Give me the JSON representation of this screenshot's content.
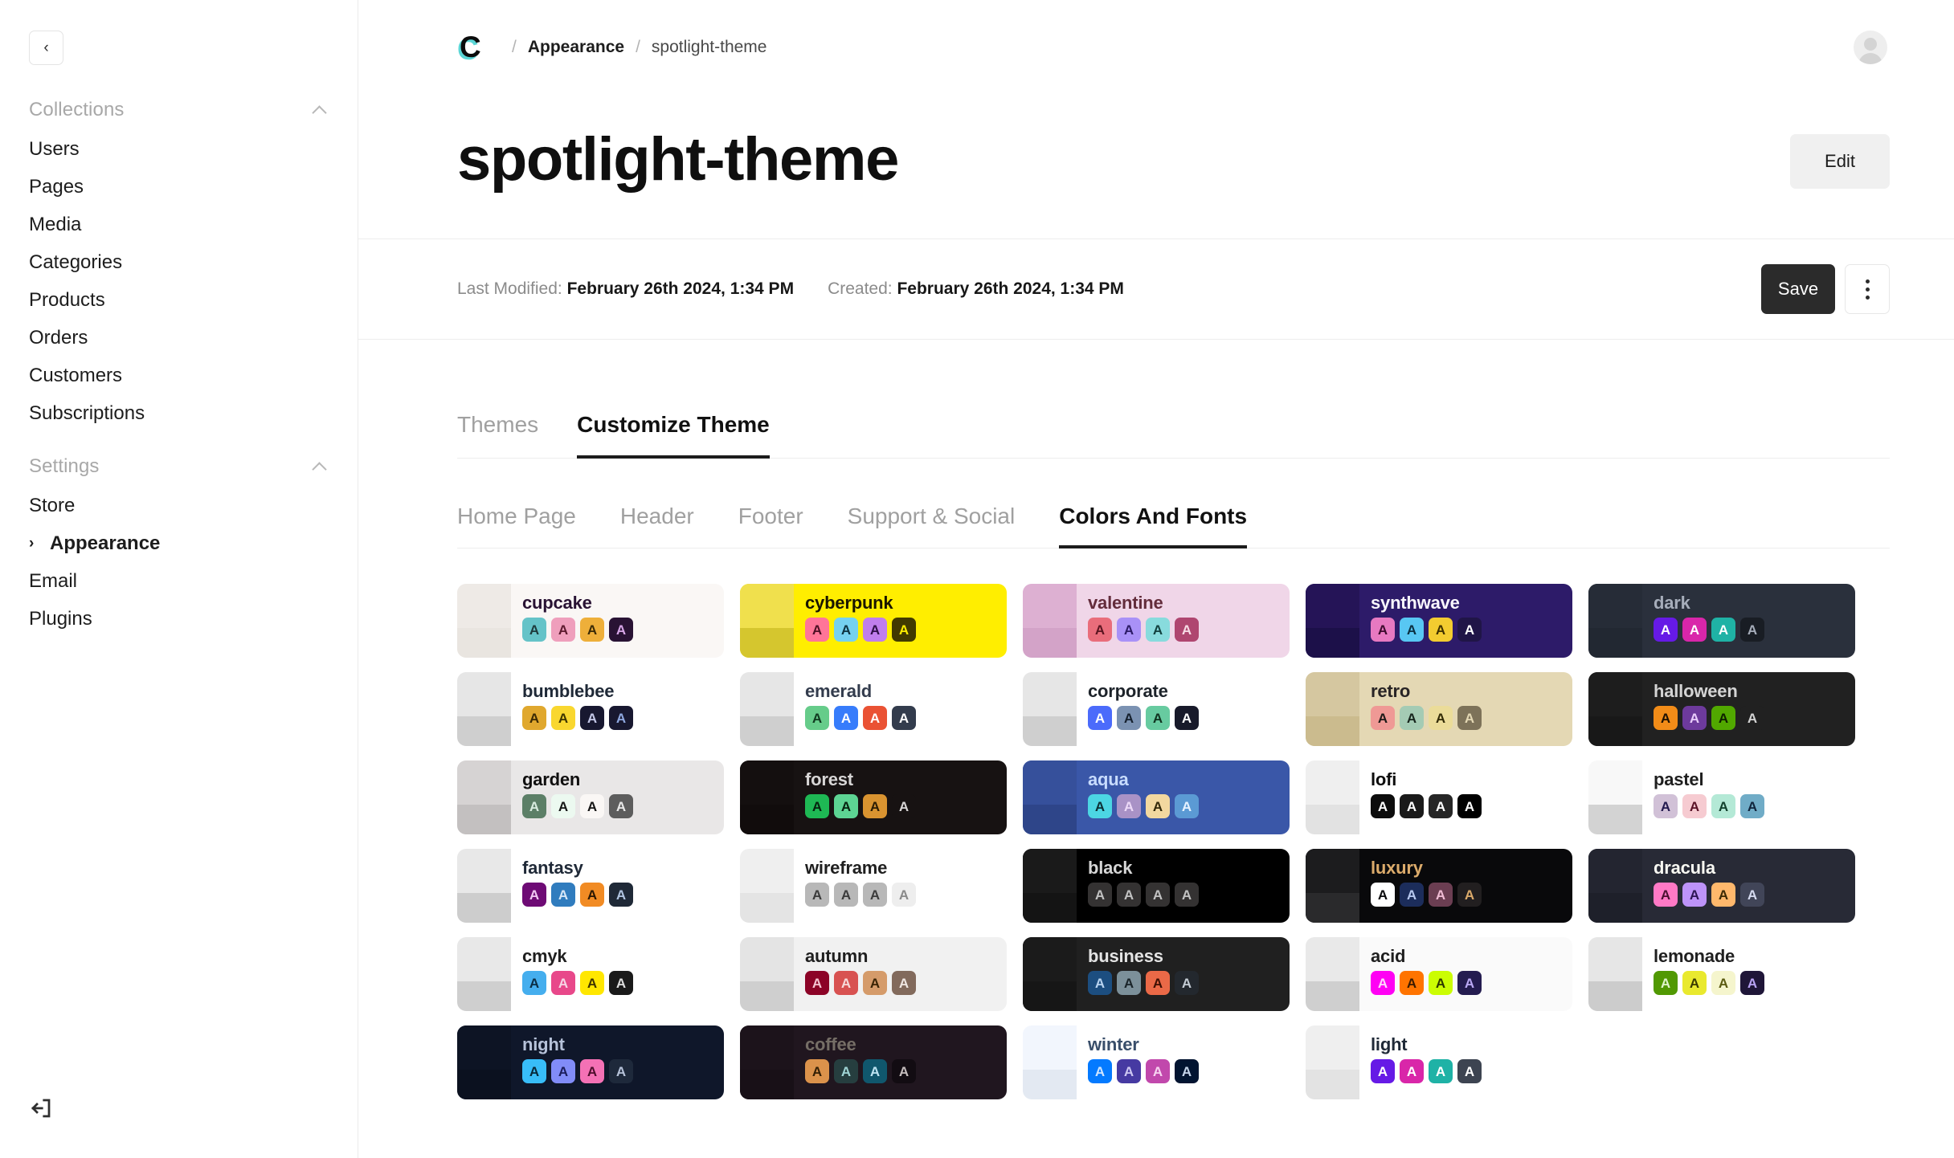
{
  "sidebar": {
    "collapse_label": "‹",
    "groups": [
      {
        "title": "Collections",
        "items": [
          {
            "label": "Users"
          },
          {
            "label": "Pages"
          },
          {
            "label": "Media"
          },
          {
            "label": "Categories"
          },
          {
            "label": "Products"
          },
          {
            "label": "Orders"
          },
          {
            "label": "Customers"
          },
          {
            "label": "Subscriptions"
          }
        ]
      },
      {
        "title": "Settings",
        "items": [
          {
            "label": "Store"
          },
          {
            "label": "Appearance",
            "active": true,
            "arrow": "›"
          },
          {
            "label": "Email"
          },
          {
            "label": "Plugins"
          }
        ]
      }
    ],
    "logout_icon": "logout-icon"
  },
  "topbar": {
    "logo_letter": "C",
    "breadcrumb": {
      "separator": "/",
      "parent": "Appearance",
      "current": "spotlight-theme"
    },
    "avatar_icon": "user-avatar-icon"
  },
  "header": {
    "title": "spotlight-theme",
    "edit_label": "Edit"
  },
  "meta": {
    "last_modified_label": "Last Modified:",
    "last_modified_value": "February 26th 2024, 1:34 PM",
    "created_label": "Created:",
    "created_value": "February 26th 2024, 1:34 PM",
    "save_label": "Save",
    "kebab_label": "More options"
  },
  "tabs_primary": [
    {
      "label": "Themes",
      "active": false
    },
    {
      "label": "Customize Theme",
      "active": true
    }
  ],
  "tabs_secondary": [
    {
      "label": "Home Page",
      "active": false
    },
    {
      "label": "Header",
      "active": false
    },
    {
      "label": "Footer",
      "active": false
    },
    {
      "label": "Support & Social",
      "active": false
    },
    {
      "label": "Colors And Fonts",
      "active": true
    }
  ],
  "themes": [
    {
      "name": "cupcake",
      "bg": "#faf7f5",
      "strip_top": "#eeeae6",
      "strip_bot": "#e9e5e0",
      "name_color": "#291334",
      "swatches": [
        {
          "bg": "#65c3c8",
          "fg": "#1e3a3b"
        },
        {
          "bg": "#ef9fbc",
          "fg": "#5c1a2e"
        },
        {
          "bg": "#eeaf3a",
          "fg": "#3a2a06"
        },
        {
          "bg": "#291334",
          "fg": "#d8a7e8"
        }
      ]
    },
    {
      "name": "cyberpunk",
      "bg": "#ffee00",
      "strip_top": "#f0e04d",
      "strip_bot": "#d5c62e",
      "name_color": "#1a1600",
      "swatches": [
        {
          "bg": "#ff7598",
          "fg": "#4d1024"
        },
        {
          "bg": "#75d1f0",
          "fg": "#0d3340"
        },
        {
          "bg": "#c07eec",
          "fg": "#2f0f47"
        },
        {
          "bg": "#423a00",
          "fg": "#ffee00"
        }
      ]
    },
    {
      "name": "valentine",
      "bg": "#f0d6e8",
      "strip_top": "#ddb0d2",
      "strip_bot": "#d3a3c8",
      "name_color": "#632c3b",
      "swatches": [
        {
          "bg": "#e96d7b",
          "fg": "#5a1520"
        },
        {
          "bg": "#a991f7",
          "fg": "#2c1b67"
        },
        {
          "bg": "#88dbdd",
          "fg": "#12413f"
        },
        {
          "bg": "#af4670",
          "fg": "#f7dce6"
        }
      ]
    },
    {
      "name": "synthwave",
      "bg": "#2d1b69",
      "strip_top": "#251457",
      "strip_bot": "#1c1049",
      "name_color": "#f9f7fd",
      "swatches": [
        {
          "bg": "#e779c1",
          "fg": "#3b0a2c"
        },
        {
          "bg": "#58c7f3",
          "fg": "#0b2f40"
        },
        {
          "bg": "#f3cc30",
          "fg": "#3d3000"
        },
        {
          "bg": "#201547",
          "fg": "#ffffff"
        }
      ]
    },
    {
      "name": "dark",
      "bg": "#2a303c",
      "strip_top": "#262c37",
      "strip_bot": "#222832",
      "name_color": "#a6adba",
      "swatches": [
        {
          "bg": "#661ae6",
          "fg": "#ffffff"
        },
        {
          "bg": "#d926aa",
          "fg": "#ffffff"
        },
        {
          "bg": "#1fb2a5",
          "fg": "#ffffff"
        },
        {
          "bg": "#191d24",
          "fg": "#a6adba"
        }
      ]
    },
    {
      "name": "bumblebee",
      "bg": "#ffffff",
      "strip_top": "#e6e6e6",
      "strip_bot": "#cfcfcf",
      "name_color": "#1f2937",
      "swatches": [
        {
          "bg": "#e0a82e",
          "fg": "#3b2a04"
        },
        {
          "bg": "#f9d72f",
          "fg": "#3d3400"
        },
        {
          "bg": "#181830",
          "fg": "#c5c8e8"
        },
        {
          "bg": "#181830",
          "fg": "#8fa8e0"
        }
      ]
    },
    {
      "name": "emerald",
      "bg": "#ffffff",
      "strip_top": "#e6e6e6",
      "strip_bot": "#cfcfcf",
      "name_color": "#333c4d",
      "swatches": [
        {
          "bg": "#66cc8a",
          "fg": "#10391f"
        },
        {
          "bg": "#377cfb",
          "fg": "#ffffff"
        },
        {
          "bg": "#ea5234",
          "fg": "#ffffff"
        },
        {
          "bg": "#333c4d",
          "fg": "#ffffff"
        }
      ]
    },
    {
      "name": "corporate",
      "bg": "#ffffff",
      "strip_top": "#e6e6e6",
      "strip_bot": "#cfcfcf",
      "name_color": "#1d232a",
      "swatches": [
        {
          "bg": "#4b6bfb",
          "fg": "#ffffff"
        },
        {
          "bg": "#7b92b2",
          "fg": "#15202e"
        },
        {
          "bg": "#67cba0",
          "fg": "#10331f"
        },
        {
          "bg": "#181a2a",
          "fg": "#ffffff"
        }
      ]
    },
    {
      "name": "retro",
      "bg": "#e4d8b4",
      "strip_top": "#d5c7a0",
      "strip_bot": "#cbbb8e",
      "name_color": "#282425",
      "swatches": [
        {
          "bg": "#ef9995",
          "fg": "#1c1917"
        },
        {
          "bg": "#a4cbb4",
          "fg": "#16241c"
        },
        {
          "bg": "#ebdc99",
          "fg": "#322b06"
        },
        {
          "bg": "#7d7259",
          "fg": "#e4d8b4"
        }
      ]
    },
    {
      "name": "halloween",
      "bg": "#212121",
      "strip_top": "#1d1d1d",
      "strip_bot": "#181818",
      "name_color": "#d4d4d4",
      "swatches": [
        {
          "bg": "#f28c18",
          "fg": "#1d1102"
        },
        {
          "bg": "#6d3a9c",
          "fg": "#e9cdfb"
        },
        {
          "bg": "#51a800",
          "fg": "#0e1f00"
        },
        {
          "bg": "#212121",
          "fg": "#d4d4d4"
        }
      ]
    },
    {
      "name": "garden",
      "bg": "#e9e7e7",
      "strip_top": "#d6d3d3",
      "strip_bot": "#c3c0c0",
      "name_color": "#100f0f",
      "swatches": [
        {
          "bg": "#5c7f67",
          "fg": "#d9ece0"
        },
        {
          "bg": "#ecf9f0",
          "fg": "#151515"
        },
        {
          "bg": "#faf7f5",
          "fg": "#151515"
        },
        {
          "bg": "#5d5d5d",
          "fg": "#e8e8e8"
        }
      ]
    },
    {
      "name": "forest",
      "bg": "#171212",
      "strip_top": "#140f0f",
      "strip_bot": "#110c0c",
      "name_color": "#d8d6d6",
      "swatches": [
        {
          "bg": "#1eb854",
          "fg": "#06230f"
        },
        {
          "bg": "#5dd493",
          "fg": "#06230f"
        },
        {
          "bg": "#d99330",
          "fg": "#2b1c03"
        },
        {
          "bg": "#171212",
          "fg": "#d8d6d6"
        }
      ]
    },
    {
      "name": "aqua",
      "bg": "#3a57a8",
      "strip_top": "#36509b",
      "strip_bot": "#2e4589",
      "name_color": "#c8dcff",
      "swatches": [
        {
          "bg": "#4cd6e3",
          "fg": "#0d3035"
        },
        {
          "bg": "#a992c6",
          "fg": "#ecd9f7"
        },
        {
          "bg": "#f2d89f",
          "fg": "#33290a"
        },
        {
          "bg": "#5b9ad4",
          "fg": "#e6f2ff"
        }
      ]
    },
    {
      "name": "lofi",
      "bg": "#ffffff",
      "strip_top": "#efefef",
      "strip_bot": "#e2e2e2",
      "name_color": "#0d0d0d",
      "swatches": [
        {
          "bg": "#0d0d0d",
          "fg": "#ffffff"
        },
        {
          "bg": "#1a1a1a",
          "fg": "#ffffff"
        },
        {
          "bg": "#262626",
          "fg": "#ffffff"
        },
        {
          "bg": "#000000",
          "fg": "#ffffff"
        }
      ]
    },
    {
      "name": "pastel",
      "bg": "#ffffff",
      "strip_top": "#f8f8f8",
      "strip_bot": "#d3d3d3",
      "name_color": "#1f1f1f",
      "swatches": [
        {
          "bg": "#d1c1d7",
          "fg": "#22194e"
        },
        {
          "bg": "#f6cbd1",
          "fg": "#5a1226"
        },
        {
          "bg": "#b4e9d6",
          "fg": "#12402c"
        },
        {
          "bg": "#70acc7",
          "fg": "#10243c"
        }
      ]
    },
    {
      "name": "fantasy",
      "bg": "#ffffff",
      "strip_top": "#e8e8e8",
      "strip_bot": "#cdcdcd",
      "name_color": "#1f2937",
      "swatches": [
        {
          "bg": "#6e0b75",
          "fg": "#f0c8f3"
        },
        {
          "bg": "#307cbe",
          "fg": "#d6e7f7"
        },
        {
          "bg": "#f18b24",
          "fg": "#2b1702"
        },
        {
          "bg": "#1f2937",
          "fg": "#b0c4e0"
        }
      ]
    },
    {
      "name": "wireframe",
      "bg": "#ffffff",
      "strip_top": "#efefef",
      "strip_bot": "#e4e4e4",
      "name_color": "#1f1f1f",
      "swatches": [
        {
          "bg": "#b8b8b8",
          "fg": "#3b3b3b"
        },
        {
          "bg": "#b8b8b8",
          "fg": "#3b3b3b"
        },
        {
          "bg": "#b8b8b8",
          "fg": "#3b3b3b"
        },
        {
          "bg": "#eeeeee",
          "fg": "#8a8a8a"
        }
      ]
    },
    {
      "name": "black",
      "bg": "#000000",
      "strip_top": "#1a1a1a",
      "strip_bot": "#141414",
      "name_color": "#d6d6d6",
      "swatches": [
        {
          "bg": "#343232",
          "fg": "#c2c2c2"
        },
        {
          "bg": "#343232",
          "fg": "#c2c2c2"
        },
        {
          "bg": "#343232",
          "fg": "#c2c2c2"
        },
        {
          "bg": "#343232",
          "fg": "#c2c2c2"
        }
      ]
    },
    {
      "name": "luxury",
      "bg": "#09090b",
      "strip_top": "#1c1c1e",
      "strip_bot": "#2a2a2c",
      "name_color": "#dcab6b",
      "swatches": [
        {
          "bg": "#ffffff",
          "fg": "#09090b"
        },
        {
          "bg": "#1c2d5b",
          "fg": "#b8c9f0"
        },
        {
          "bg": "#6b3e52",
          "fg": "#f0bcd4"
        },
        {
          "bg": "#221f20",
          "fg": "#dcab6b"
        }
      ]
    },
    {
      "name": "dracula",
      "bg": "#282a36",
      "strip_top": "#232530",
      "strip_bot": "#1e202a",
      "name_color": "#f8f8f2",
      "swatches": [
        {
          "bg": "#ff79c6",
          "fg": "#4a1030"
        },
        {
          "bg": "#bd93f9",
          "fg": "#2c1554"
        },
        {
          "bg": "#ffb86c",
          "fg": "#3d2a05"
        },
        {
          "bg": "#414558",
          "fg": "#d6dbf0"
        }
      ]
    },
    {
      "name": "cmyk",
      "bg": "#ffffff",
      "strip_top": "#e8e8e8",
      "strip_bot": "#cfcfcf",
      "name_color": "#1f1f1f",
      "swatches": [
        {
          "bg": "#45aeee",
          "fg": "#0b2d44"
        },
        {
          "bg": "#e8488a",
          "fg": "#f7d5e5"
        },
        {
          "bg": "#ffe700",
          "fg": "#3d3500"
        },
        {
          "bg": "#1a1a1a",
          "fg": "#dedede"
        }
      ]
    },
    {
      "name": "autumn",
      "bg": "#f1f1f1",
      "strip_top": "#e4e4e4",
      "strip_bot": "#cfcfcf",
      "name_color": "#1f1f1f",
      "swatches": [
        {
          "bg": "#8c0327",
          "fg": "#f5c5d2"
        },
        {
          "bg": "#d85251",
          "fg": "#f7dada"
        },
        {
          "bg": "#d59b6a",
          "fg": "#3a2304"
        },
        {
          "bg": "#826a5c",
          "fg": "#f0e7e2"
        }
      ]
    },
    {
      "name": "business",
      "bg": "#202020",
      "strip_top": "#1b1b1b",
      "strip_bot": "#161616",
      "name_color": "#e4e4e4",
      "swatches": [
        {
          "bg": "#1c4e80",
          "fg": "#b9d4f0"
        },
        {
          "bg": "#7c909a",
          "fg": "#1a2429"
        },
        {
          "bg": "#ea6947",
          "fg": "#3d0f03"
        },
        {
          "bg": "#23282e",
          "fg": "#c4ccd4"
        }
      ]
    },
    {
      "name": "acid",
      "bg": "#fafafa",
      "strip_top": "#e9e9e9",
      "strip_bot": "#cfcfcf",
      "name_color": "#1f1f1f",
      "swatches": [
        {
          "bg": "#ff00f4",
          "fg": "#ffd6fc"
        },
        {
          "bg": "#ff7400",
          "fg": "#3a1a00"
        },
        {
          "bg": "#cbfd03",
          "fg": "#2c3800"
        },
        {
          "bg": "#241c50",
          "fg": "#bba9f5"
        }
      ]
    },
    {
      "name": "lemonade",
      "bg": "#ffffff",
      "strip_top": "#e6e6e6",
      "strip_bot": "#cccccc",
      "name_color": "#1f1f1f",
      "swatches": [
        {
          "bg": "#519903",
          "fg": "#e0f5cd"
        },
        {
          "bg": "#e9e92e",
          "fg": "#3b3b00"
        },
        {
          "bg": "#f5f5cd",
          "fg": "#5a5a10"
        },
        {
          "bg": "#1f1638",
          "fg": "#b9a3f5"
        }
      ]
    },
    {
      "name": "night",
      "bg": "#0f172a",
      "strip_top": "#0d1424",
      "strip_bot": "#0b111f",
      "name_color": "#b6c2d9",
      "swatches": [
        {
          "bg": "#38bdf8",
          "fg": "#07293a"
        },
        {
          "bg": "#818cf8",
          "fg": "#1b1d5c"
        },
        {
          "bg": "#f471b5",
          "fg": "#4d0e2c"
        },
        {
          "bg": "#1e293b",
          "fg": "#b6c2d9"
        }
      ]
    },
    {
      "name": "coffee",
      "bg": "#20161f",
      "strip_top": "#1c131b",
      "strip_bot": "#181017",
      "name_color": "#756e66",
      "swatches": [
        {
          "bg": "#db924b",
          "fg": "#331f05"
        },
        {
          "bg": "#263e3f",
          "fg": "#9fd4d4"
        },
        {
          "bg": "#10576d",
          "fg": "#bde4f2"
        },
        {
          "bg": "#120c12",
          "fg": "#c5bdbd"
        }
      ]
    },
    {
      "name": "winter",
      "bg": "#ffffff",
      "strip_top": "#f2f6fd",
      "strip_bot": "#e3e9f2",
      "name_color": "#394e6a",
      "swatches": [
        {
          "bg": "#047aff",
          "fg": "#cfe5ff"
        },
        {
          "bg": "#463aa2",
          "fg": "#cdc7f2"
        },
        {
          "bg": "#c148ac",
          "fg": "#f7d3f0"
        },
        {
          "bg": "#021431",
          "fg": "#c5d4ea"
        }
      ]
    },
    {
      "name": "light",
      "bg": "#ffffff",
      "strip_top": "#efefef",
      "strip_bot": "#e3e3e3",
      "name_color": "#1f2937",
      "swatches": [
        {
          "bg": "#661ae6",
          "fg": "#ffffff"
        },
        {
          "bg": "#d926a9",
          "fg": "#ffffff"
        },
        {
          "bg": "#1fb2a6",
          "fg": "#ffffff"
        },
        {
          "bg": "#3d4451",
          "fg": "#ffffff"
        }
      ]
    }
  ]
}
